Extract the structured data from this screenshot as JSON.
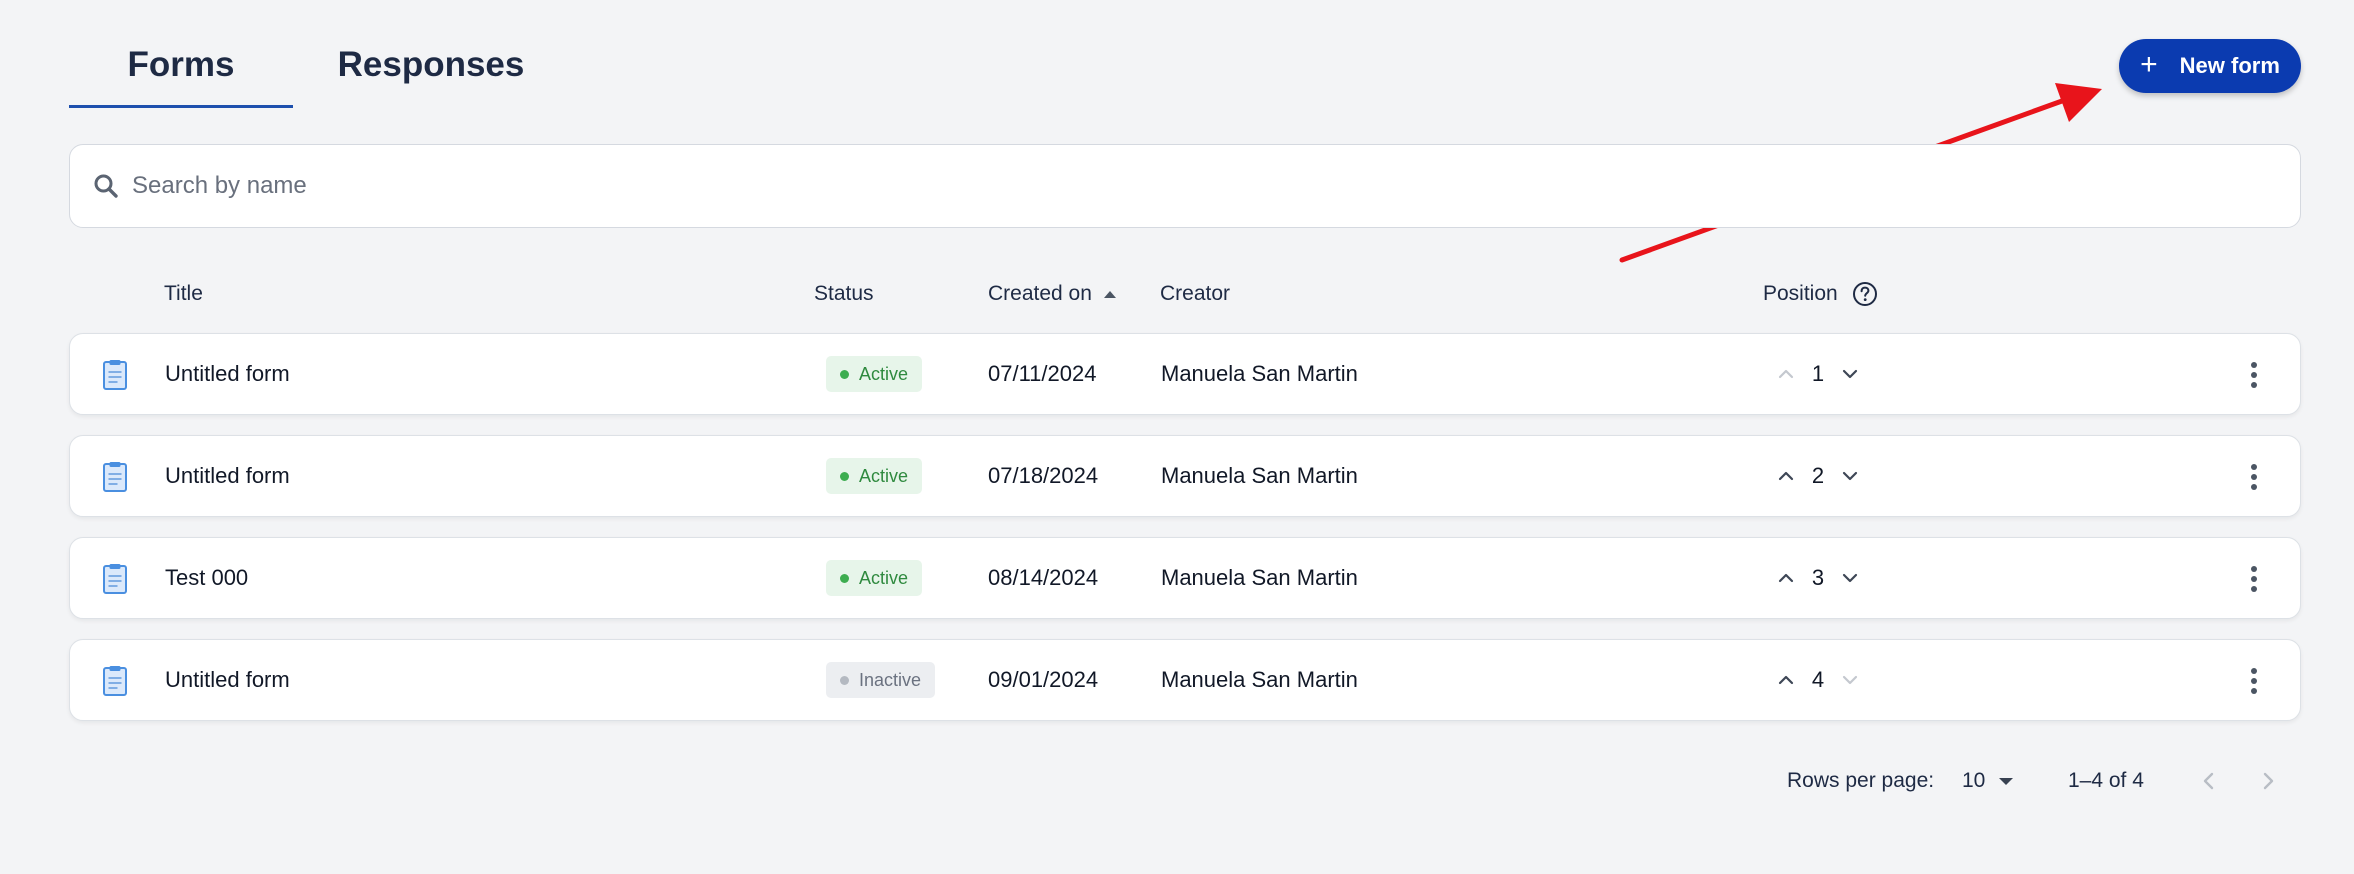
{
  "tabs": [
    {
      "label": "Forms",
      "active": true
    },
    {
      "label": "Responses",
      "active": false
    }
  ],
  "new_form_button": {
    "label": "New form",
    "icon": "plus-icon"
  },
  "search": {
    "placeholder": "Search by name",
    "value": "",
    "icon": "search-icon"
  },
  "table": {
    "columns": {
      "title": "Title",
      "status": "Status",
      "created_on": "Created on",
      "creator": "Creator",
      "position": "Position"
    },
    "sort": {
      "column": "created_on",
      "direction": "ascending"
    },
    "rows": [
      {
        "title": "Untitled form",
        "status": "Active",
        "created_on": "07/11/2024",
        "creator": "Manuela San Martin",
        "position": "1"
      },
      {
        "title": "Untitled form",
        "status": "Active",
        "created_on": "07/18/2024",
        "creator": "Manuela San Martin",
        "position": "2"
      },
      {
        "title": "Test 000",
        "status": "Active",
        "created_on": "08/14/2024",
        "creator": "Manuela San Martin",
        "position": "3"
      },
      {
        "title": "Untitled form",
        "status": "Inactive",
        "created_on": "09/01/2024",
        "creator": "Manuela San Martin",
        "position": "4"
      }
    ]
  },
  "pagination": {
    "rows_per_page_label": "Rows per page:",
    "rows_per_page": "10",
    "range": "1–4 of 4"
  },
  "colors": {
    "primary": "#0b3bb0",
    "tab_underline": "#1d4fad",
    "active_badge_bg": "#e7f5ea",
    "active_badge_text": "#2f8a3f",
    "inactive_badge_bg": "#eceef1",
    "inactive_badge_text": "#6b7280",
    "annotation_arrow": "#e8141b"
  }
}
